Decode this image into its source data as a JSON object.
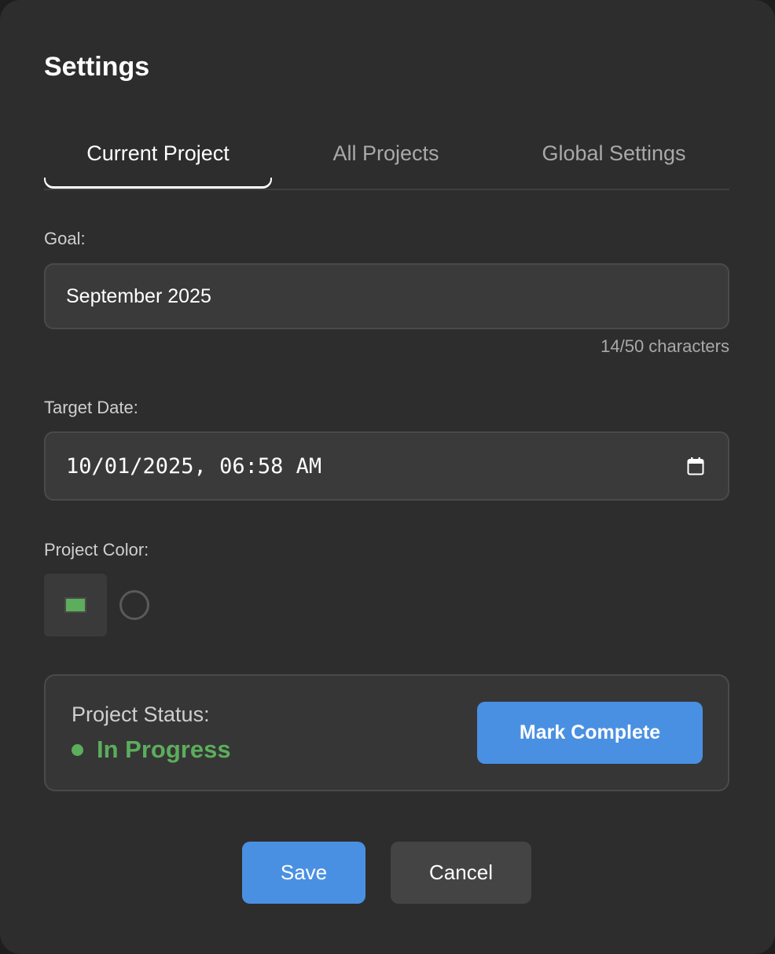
{
  "dialog": {
    "title": "Settings"
  },
  "tabs": [
    {
      "label": "Current Project",
      "active": true
    },
    {
      "label": "All Projects",
      "active": false
    },
    {
      "label": "Global Settings",
      "active": false
    }
  ],
  "goal": {
    "label": "Goal:",
    "value": "September 2025",
    "counter": "14/50 characters"
  },
  "target_date": {
    "label": "Target Date:",
    "value": "10/01/2025, 06:58 AM",
    "icon": "calendar-icon"
  },
  "project_color": {
    "label": "Project Color:",
    "selected_color": "#5cad5c"
  },
  "status": {
    "label": "Project Status:",
    "value": "In Progress",
    "color": "#5cad5c",
    "action_label": "Mark Complete"
  },
  "footer": {
    "save_label": "Save",
    "cancel_label": "Cancel"
  },
  "colors": {
    "accent": "#4a90e2",
    "background": "#2d2d2d",
    "status_green": "#5cad5c"
  }
}
